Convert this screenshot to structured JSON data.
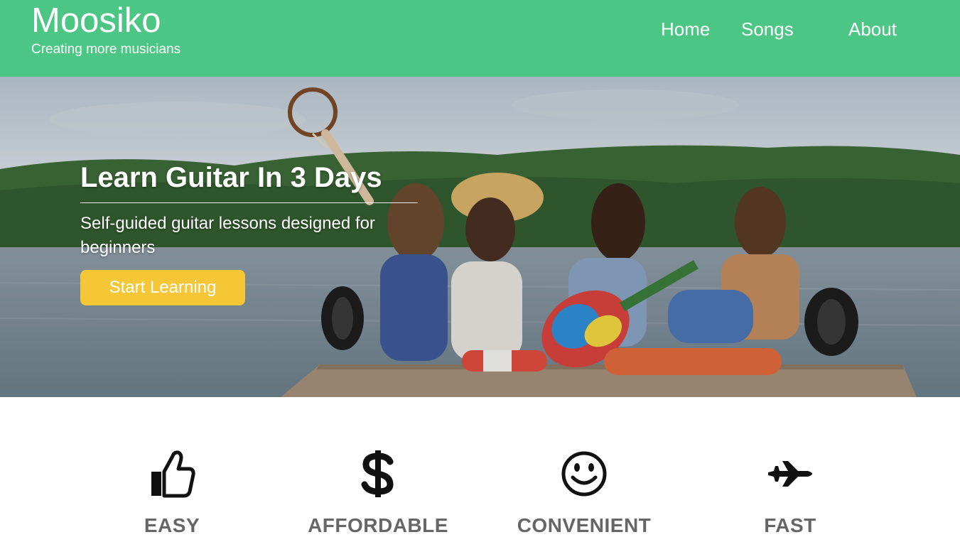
{
  "header": {
    "brand_title": "Moosiko",
    "brand_tagline": "Creating more musicians",
    "nav": [
      {
        "label": "Home"
      },
      {
        "label": "Songs"
      },
      {
        "label": "About"
      }
    ],
    "bg_color": "#4bc684"
  },
  "hero": {
    "title": "Learn Guitar In 3 Days",
    "subtitle": "Self-guided guitar lessons designed for beginners",
    "cta_label": "Start Learning",
    "cta_color": "#f5c636"
  },
  "features": [
    {
      "icon": "thumbs-up-icon",
      "label": "EASY"
    },
    {
      "icon": "dollar-icon",
      "label": "AFFORDABLE"
    },
    {
      "icon": "smiley-icon",
      "label": "CONVENIENT"
    },
    {
      "icon": "jet-plane-icon",
      "label": "FAST"
    }
  ]
}
